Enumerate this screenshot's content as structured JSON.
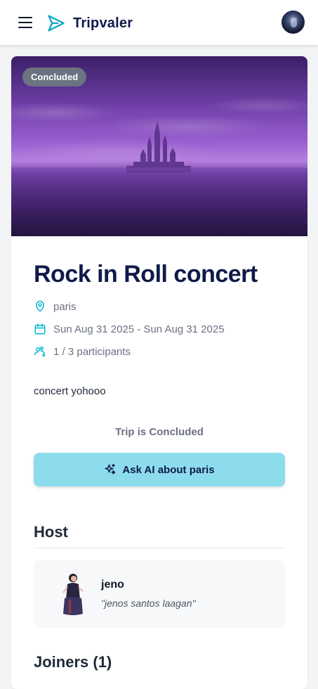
{
  "app": {
    "name": "Tripvaler"
  },
  "colors": {
    "brand": "#0f1a4a",
    "accent_icon": "#06b6d4",
    "ai_button_bg": "#8ddcee",
    "badge_bg": "#6b7280"
  },
  "trip": {
    "status_badge": "Concluded",
    "title": "Rock in Roll concert",
    "location": "paris",
    "dates": "Sun Aug 31 2025 - Sun Aug 31 2025",
    "participants": "1 / 3 participants",
    "description": "concert yohooo",
    "status_text": "Trip is Concluded",
    "ai_button_label": "Ask AI about paris"
  },
  "host": {
    "section_title": "Host",
    "name": "jeno",
    "quote": "\"jenos santos laagan\""
  },
  "joiners": {
    "section_title": "Joiners (1)"
  },
  "icons": [
    "menu-icon",
    "send-logo-icon",
    "user-avatar",
    "map-pin-icon",
    "calendar-icon",
    "participants-icon",
    "sparkles-icon"
  ]
}
